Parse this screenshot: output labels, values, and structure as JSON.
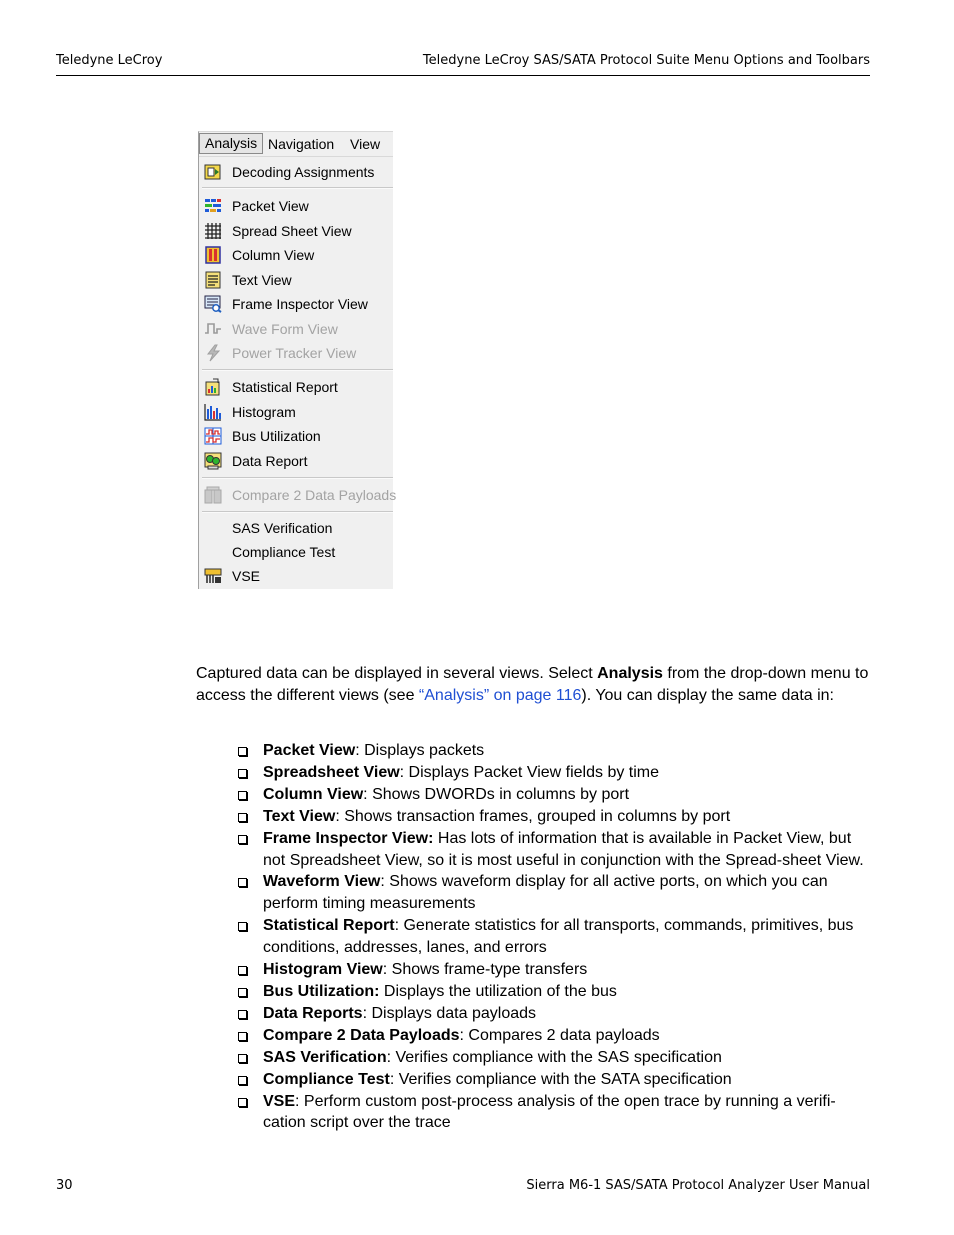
{
  "header": {
    "left": "Teledyne LeCroy",
    "right": "Teledyne LeCroy SAS/SATA Protocol Suite Menu Options and Toolbars"
  },
  "menu": {
    "bar": [
      "Analysis",
      "Navigation",
      "View"
    ],
    "items": [
      {
        "label": "Decoding Assignments",
        "icon": "decoding-assignments-icon",
        "enabled": true
      },
      {
        "label": "Packet View",
        "icon": "packet-view-icon",
        "enabled": true
      },
      {
        "label": "Spread Sheet View",
        "icon": "spreadsheet-view-icon",
        "enabled": true
      },
      {
        "label": "Column View",
        "icon": "column-view-icon",
        "enabled": true
      },
      {
        "label": "Text View",
        "icon": "text-view-icon",
        "enabled": true
      },
      {
        "label": "Frame Inspector View",
        "icon": "frame-inspector-icon",
        "enabled": true
      },
      {
        "label": "Wave Form View",
        "icon": "waveform-icon",
        "enabled": false
      },
      {
        "label": "Power Tracker View",
        "icon": "power-tracker-icon",
        "enabled": false
      },
      {
        "label": "Statistical Report",
        "icon": "statistical-report-icon",
        "enabled": true
      },
      {
        "label": "Histogram",
        "icon": "histogram-icon",
        "enabled": true
      },
      {
        "label": "Bus Utilization",
        "icon": "bus-utilization-icon",
        "enabled": true
      },
      {
        "label": "Data Report",
        "icon": "data-report-icon",
        "enabled": true
      },
      {
        "label": "Compare 2 Data Payloads",
        "icon": "compare-payloads-icon",
        "enabled": false
      },
      {
        "label": "SAS Verification",
        "icon": "",
        "enabled": true
      },
      {
        "label": "Compliance Test",
        "icon": "",
        "enabled": true
      },
      {
        "label": "VSE",
        "icon": "vse-icon",
        "enabled": true
      }
    ]
  },
  "intro": {
    "text1": "Captured data can be displayed in several views. Select ",
    "bold": "Analysis",
    "text2": " from the drop-down menu to access the different views (see ",
    "link": "“Analysis” on page 116",
    "text3": "). You can display the same data in:"
  },
  "bullets": [
    {
      "term": "Packet View",
      "desc": ": Displays packets"
    },
    {
      "term": "Spreadsheet View",
      "desc": ": Displays Packet View fields by time"
    },
    {
      "term": "Column View",
      "desc": ": Shows DWORDs in columns by port"
    },
    {
      "term": "Text View",
      "desc": ": Shows transaction frames, grouped in columns by port"
    },
    {
      "term": "Frame Inspector View:",
      "desc": " Has lots of information that is available in Packet View, but not Spreadsheet View, so it is most useful in conjunction with the Spread-sheet View."
    },
    {
      "term": "Waveform View",
      "desc": ": Shows waveform display for all active ports, on which you can perform timing measurements"
    },
    {
      "term": "Statistical Report",
      "desc": ": Generate statistics for all transports, commands, primitives, bus conditions, addresses, lanes, and errors"
    },
    {
      "term": "Histogram View",
      "desc": ": Shows frame-type transfers"
    },
    {
      "term": "Bus Utilization:",
      "desc": " Displays the utilization of the bus"
    },
    {
      "term": "Data Reports",
      "desc": ": Displays data payloads"
    },
    {
      "term": "Compare 2 Data Payloads",
      "desc": ": Compares 2 data payloads"
    },
    {
      "term": "SAS Verification",
      "desc": ": Verifies compliance with the SAS specification"
    },
    {
      "term": "Compliance Test",
      "desc": ": Verifies compliance with the SATA specification"
    },
    {
      "term": "VSE",
      "desc": ": Perform custom post-process analysis of the open trace by running a verifi-cation script over the trace"
    }
  ],
  "footer": {
    "page": "30",
    "title": "Sierra M6-1 SAS/SATA Protocol Analyzer User Manual"
  }
}
